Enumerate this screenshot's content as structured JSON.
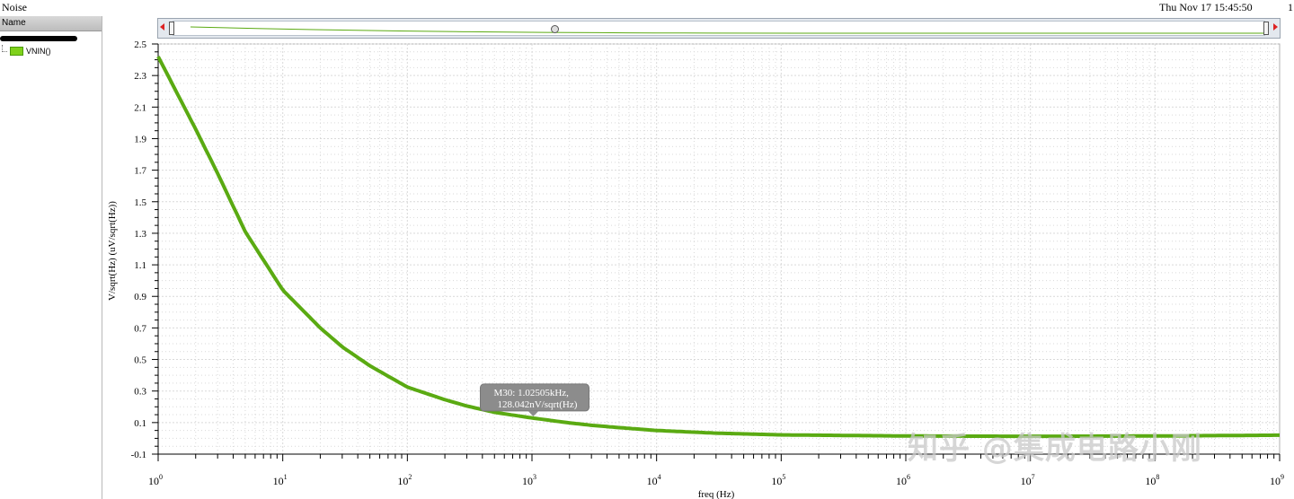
{
  "window": {
    "title": "Noise",
    "timestamp": "Thu Nov 17 15:45:50",
    "page_number": "1"
  },
  "legend": {
    "header": "Name",
    "items": [
      {
        "label": "VNIN()",
        "color": "#7fd11b"
      }
    ]
  },
  "marker": {
    "line1": "M30: 1.02505kHz,",
    "line2": "128.042nV/sqrt(Hz)"
  },
  "watermark": "知乎 @集成电路小刚",
  "colors": {
    "trace": "#5aaa12",
    "grid": "#d9d9d9",
    "marker_bg": "#8c8c8c"
  },
  "chart_data": {
    "type": "line",
    "xlabel": "freq (Hz)",
    "ylabel": "V/sqrt(Hz) (uV/sqrt(Hz))",
    "xscale": "log",
    "xlim": [
      1,
      1000000000
    ],
    "ylim": [
      -0.1,
      2.5
    ],
    "yticks": [
      "2.5",
      "2.3",
      "2.1",
      "1.9",
      "1.7",
      "1.5",
      "1.3",
      "1.1",
      "0.9",
      "0.7",
      "0.5",
      "0.3",
      "0.1",
      "-0.1"
    ],
    "xticks": [
      {
        "base": "10",
        "exp": "0"
      },
      {
        "base": "10",
        "exp": "1"
      },
      {
        "base": "10",
        "exp": "2"
      },
      {
        "base": "10",
        "exp": "3"
      },
      {
        "base": "10",
        "exp": "4"
      },
      {
        "base": "10",
        "exp": "5"
      },
      {
        "base": "10",
        "exp": "6"
      },
      {
        "base": "10",
        "exp": "7"
      },
      {
        "base": "10",
        "exp": "8"
      },
      {
        "base": "10",
        "exp": "9"
      }
    ],
    "grid": true,
    "series": [
      {
        "name": "VNIN()",
        "x": [
          1,
          2,
          3,
          5,
          10,
          20,
          30,
          50,
          100,
          200,
          300,
          500,
          1025.05,
          2000,
          3000,
          5000,
          10000,
          30000,
          100000,
          1000000,
          10000000,
          100000000,
          1000000000
        ],
        "y": [
          2.42,
          1.96,
          1.68,
          1.31,
          0.94,
          0.7,
          0.58,
          0.46,
          0.325,
          0.245,
          0.205,
          0.165,
          0.128,
          0.098,
          0.083,
          0.068,
          0.05,
          0.033,
          0.022,
          0.015,
          0.013,
          0.015,
          0.02
        ]
      }
    ],
    "markers": [
      {
        "name": "M30",
        "x": 1025.05,
        "y": 0.128042
      }
    ]
  }
}
